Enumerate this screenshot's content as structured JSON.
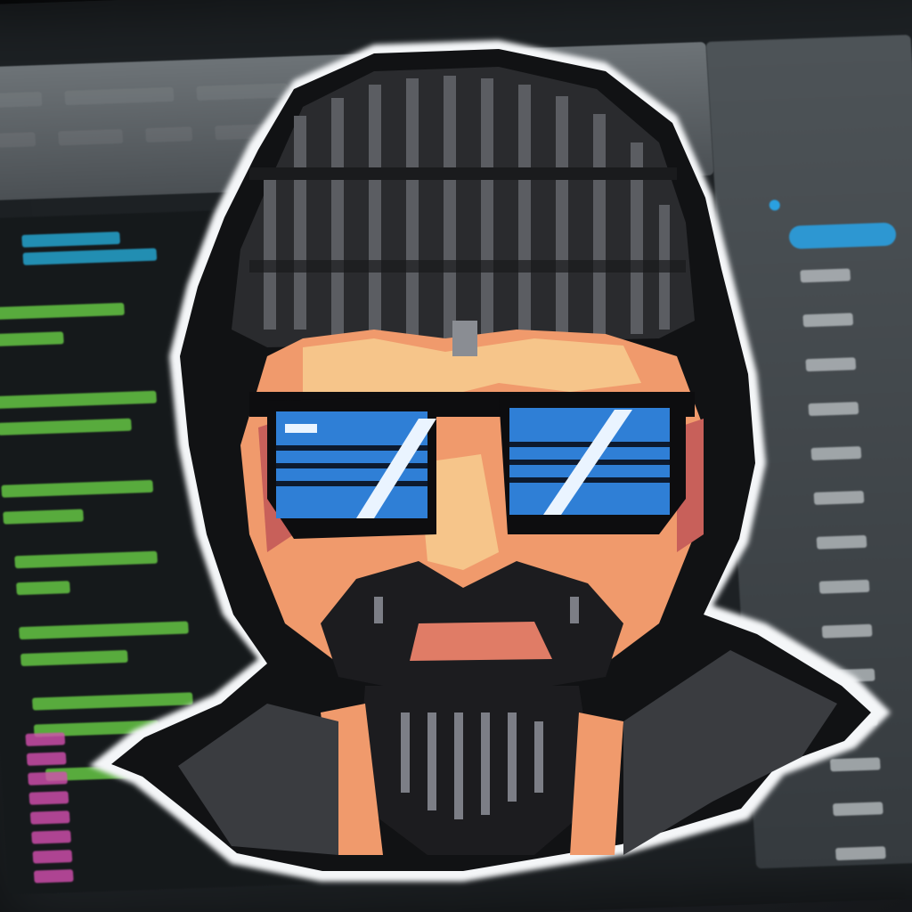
{
  "scene": {
    "subject": "pixel-art-hacker-sticker",
    "background": "blurred-code-editor-monitor"
  },
  "colors": {
    "beanie": "#2a2b2e",
    "beanie_rib": "#5b5d62",
    "skin_light": "#f6c58a",
    "skin_mid": "#f09a6c",
    "skin_shadow": "#c8605a",
    "lens_blue": "#2f7fd6",
    "lens_glare": "#eaf4ff",
    "beard": "#1c1c1f",
    "beard_highlight": "#7c7e86",
    "sticker_border": "#f4f6f8",
    "code_green": "#6fdc4a",
    "code_cyan": "#27b6e6",
    "code_magenta": "#d44fb0",
    "ui_accent": "#2aa0e0"
  },
  "icons": {
    "side_dot": "blue-dot-icon"
  }
}
